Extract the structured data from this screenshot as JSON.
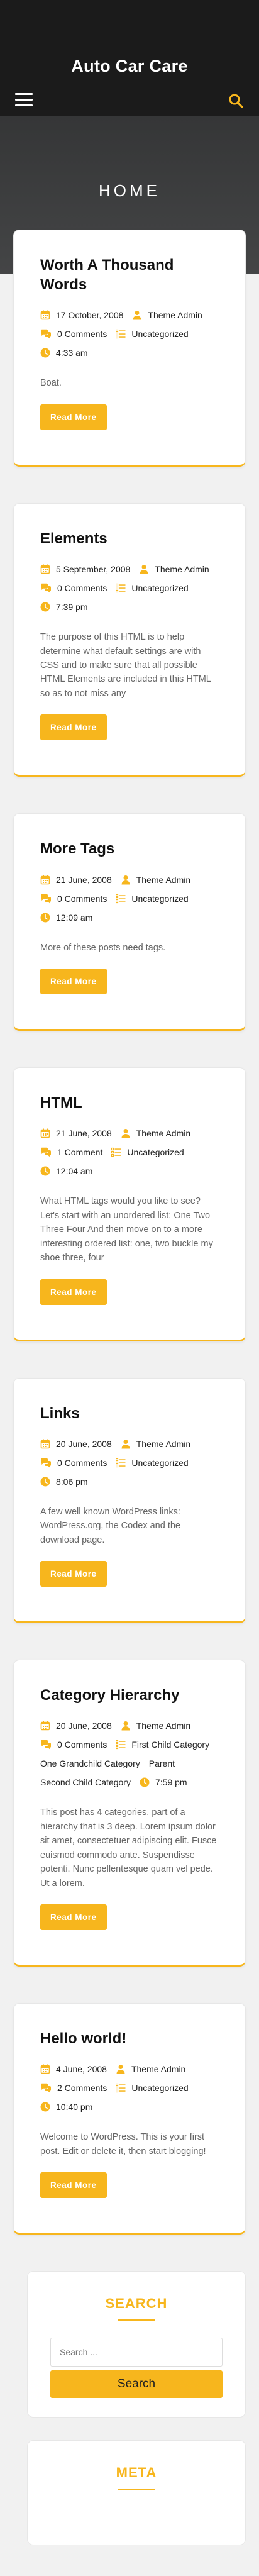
{
  "site": {
    "title": "Auto Car Care"
  },
  "hero": {
    "title": "HOME"
  },
  "colors": {
    "accent": "#f7b61d",
    "header_bg": "#1b1b1b"
  },
  "read_more_label": "Read More",
  "posts": [
    {
      "title": "Worth A Thousand Words",
      "date": "17 October, 2008",
      "author": "Theme Admin",
      "comments": "0 Comments",
      "category": "Uncategorized",
      "time": "4:33 am",
      "excerpt": "Boat."
    },
    {
      "title": "Elements",
      "date": "5 September, 2008",
      "author": "Theme Admin",
      "comments": "0 Comments",
      "category": "Uncategorized",
      "time": "7:39 pm",
      "excerpt": "The purpose of this HTML is to help determine what default settings are with CSS and to make sure that all possible HTML Elements are included in this HTML so as to not miss any"
    },
    {
      "title": "More Tags",
      "date": "21 June, 2008",
      "author": "Theme Admin",
      "comments": "0 Comments",
      "category": "Uncategorized",
      "time": "12:09 am",
      "excerpt": "More of these posts need tags."
    },
    {
      "title": "HTML",
      "date": "21 June, 2008",
      "author": "Theme Admin",
      "comments": "1 Comment",
      "category": "Uncategorized",
      "time": "12:04 am",
      "excerpt": "What HTML tags would you like to see? Let's start with an unordered list: One Two Three Four And then move on to a more interesting ordered list: one, two buckle my shoe three, four"
    },
    {
      "title": "Links",
      "date": "20 June, 2008",
      "author": "Theme Admin",
      "comments": "0 Comments",
      "category": "Uncategorized",
      "time": "8:06 pm",
      "excerpt": "A few well known WordPress links: WordPress.org, the Codex and the download page."
    },
    {
      "title": "Category Hierarchy",
      "date": "20 June, 2008",
      "author": "Theme Admin",
      "comments": "0 Comments",
      "categories": [
        "First Child Category",
        "One Grandchild Category",
        "Parent",
        "Second Child Category"
      ],
      "time": "7:59 pm",
      "excerpt": "This post has 4 categories, part of a hierarchy that is 3 deep. Lorem ipsum dolor sit amet, consectetuer adipiscing elit. Fusce euismod commodo ante. Suspendisse potenti. Nunc pellentesque quam vel pede. Ut a lorem."
    },
    {
      "title": "Hello world!",
      "date": "4 June, 2008",
      "author": "Theme Admin",
      "comments": "2 Comments",
      "category": "Uncategorized",
      "time": "10:40 pm",
      "excerpt": "Welcome to WordPress. This is your first post. Edit or delete it, then start blogging!"
    }
  ],
  "search_widget": {
    "title": "SEARCH",
    "placeholder": "Search ...",
    "button": "Search"
  },
  "meta_widget": {
    "title": "META"
  }
}
